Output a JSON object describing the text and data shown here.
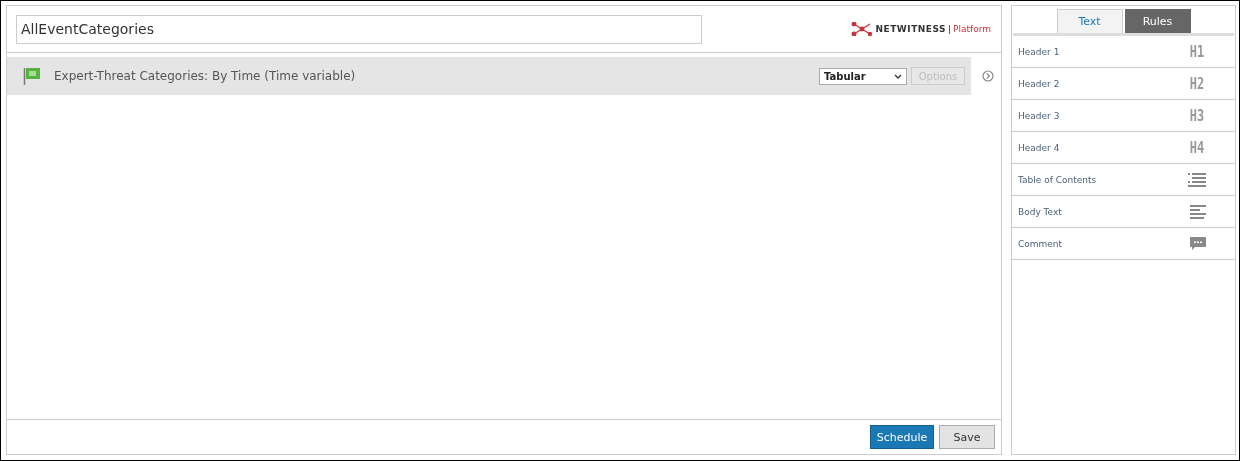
{
  "report": {
    "name": "AllEventCategories"
  },
  "logo": {
    "brand": "NETWITNESS",
    "product": "Platform"
  },
  "widgets": [
    {
      "title": "Expert-Threat Categories: By Time (Time variable)",
      "view": "Tabular",
      "options": {
        "label": "Options",
        "disabled": true
      }
    }
  ],
  "footer": {
    "buttons": [
      {
        "label": "Schedule",
        "kind": "primary"
      },
      {
        "label": "Save",
        "kind": "secondary"
      }
    ]
  },
  "tabs": [
    {
      "label": "Text",
      "selected": false
    },
    {
      "label": "Rules",
      "selected": true
    }
  ],
  "rules": [
    {
      "label": "Header 1",
      "kind": "heading",
      "mark": "H1"
    },
    {
      "label": "Header 2",
      "kind": "heading",
      "mark": "H2"
    },
    {
      "label": "Header 3",
      "kind": "heading",
      "mark": "H3"
    },
    {
      "label": "Header 4",
      "kind": "heading",
      "mark": "H4"
    },
    {
      "label": "Table of Contents",
      "kind": "toc"
    },
    {
      "label": "Body Text",
      "kind": "body"
    },
    {
      "label": "Comment",
      "kind": "comment"
    }
  ]
}
